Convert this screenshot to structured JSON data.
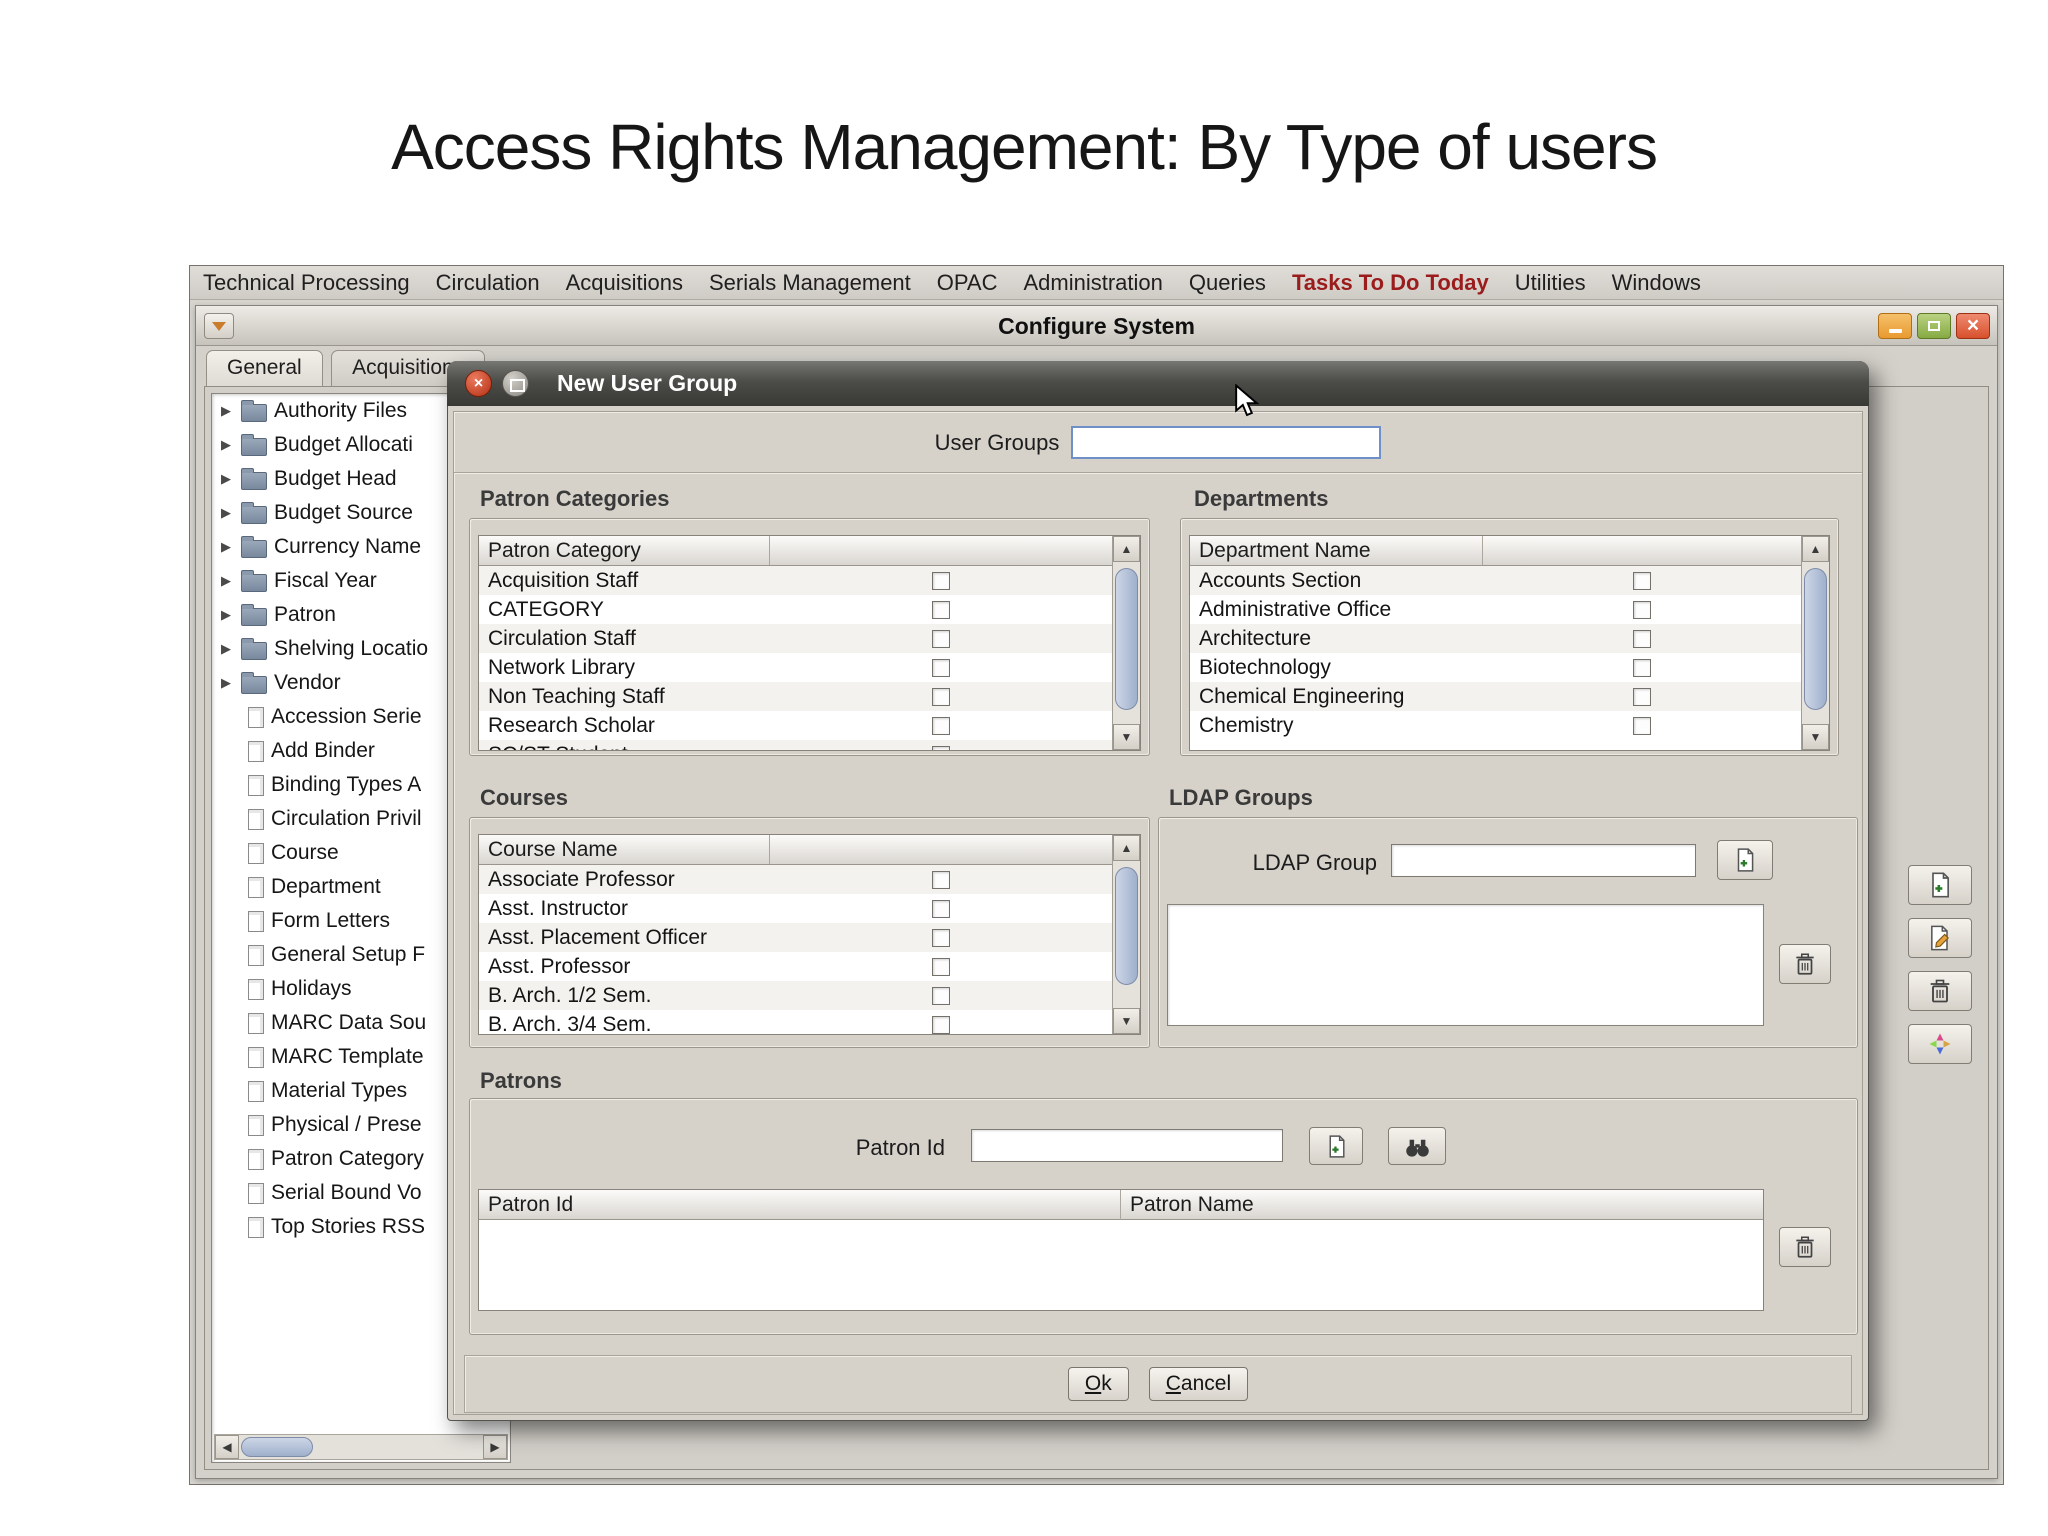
{
  "slide": {
    "title": "Access Rights Management: By Type of users"
  },
  "icons": {
    "expand": "▶",
    "up": "▲",
    "down": "▼",
    "left": "◀",
    "right": "▶",
    "window_close": "×",
    "dialog_close": "×"
  },
  "menu": {
    "accent_color": "#9b1c1c",
    "items": [
      {
        "label": "Technical Processing"
      },
      {
        "label": "Circulation"
      },
      {
        "label": "Acquisitions"
      },
      {
        "label": "Serials Management"
      },
      {
        "label": "OPAC"
      },
      {
        "label": "Administration"
      },
      {
        "label": "Queries"
      },
      {
        "label": "Tasks To Do Today",
        "class": "accent"
      },
      {
        "label": "Utilities"
      },
      {
        "label": "Windows"
      }
    ]
  },
  "window": {
    "title": "Configure System",
    "tabs": [
      {
        "label": "General",
        "class": "active"
      },
      {
        "label": "Acquisitions"
      }
    ]
  },
  "tree": {
    "folders": [
      "Authority Files",
      "Budget Allocati",
      "Budget Head",
      "Budget Source",
      "Currency Name",
      "Fiscal Year",
      "Patron",
      "Shelving Locatio",
      "Vendor"
    ],
    "documents": [
      "Accession Serie",
      "Add Binder",
      "Binding Types A",
      "Circulation Privil",
      "Course",
      "Department",
      "Form Letters",
      "General Setup F",
      "Holidays",
      "MARC Data Sou",
      "MARC Template",
      "Material Types",
      "Physical / Prese",
      "Patron Category",
      "Serial Bound Vo",
      "Top Stories RSS"
    ]
  },
  "dialog": {
    "title": "New User Group",
    "user_groups": {
      "label": "User Groups",
      "value": ""
    },
    "patron_categories": {
      "title": "Patron Categories",
      "column": "Patron Category",
      "rows": [
        "Acquisition Staff",
        "CATEGORY",
        "Circulation Staff",
        "Network Library",
        "Non Teaching Staff",
        "Research Scholar",
        "SC/ST Student"
      ]
    },
    "departments": {
      "title": "Departments",
      "column": "Department Name",
      "rows": [
        "Accounts Section",
        "Administrative Office",
        "Architecture",
        "Biotechnology",
        "Chemical Engineering",
        "Chemistry"
      ]
    },
    "courses": {
      "title": "Courses",
      "column": "Course Name",
      "rows": [
        "Associate Professor",
        "Asst. Instructor",
        "Asst. Placement Officer",
        "Asst. Professor",
        "B. Arch. 1/2 Sem.",
        "B. Arch. 3/4 Sem."
      ]
    },
    "ldap": {
      "title": "LDAP Groups",
      "label": "LDAP Group",
      "value": ""
    },
    "patrons": {
      "title": "Patrons",
      "label": "Patron Id",
      "value": "",
      "columns": [
        "Patron Id",
        "Patron Name"
      ],
      "rows": []
    },
    "buttons": {
      "ok": "Ok",
      "cancel": "Cancel"
    }
  }
}
